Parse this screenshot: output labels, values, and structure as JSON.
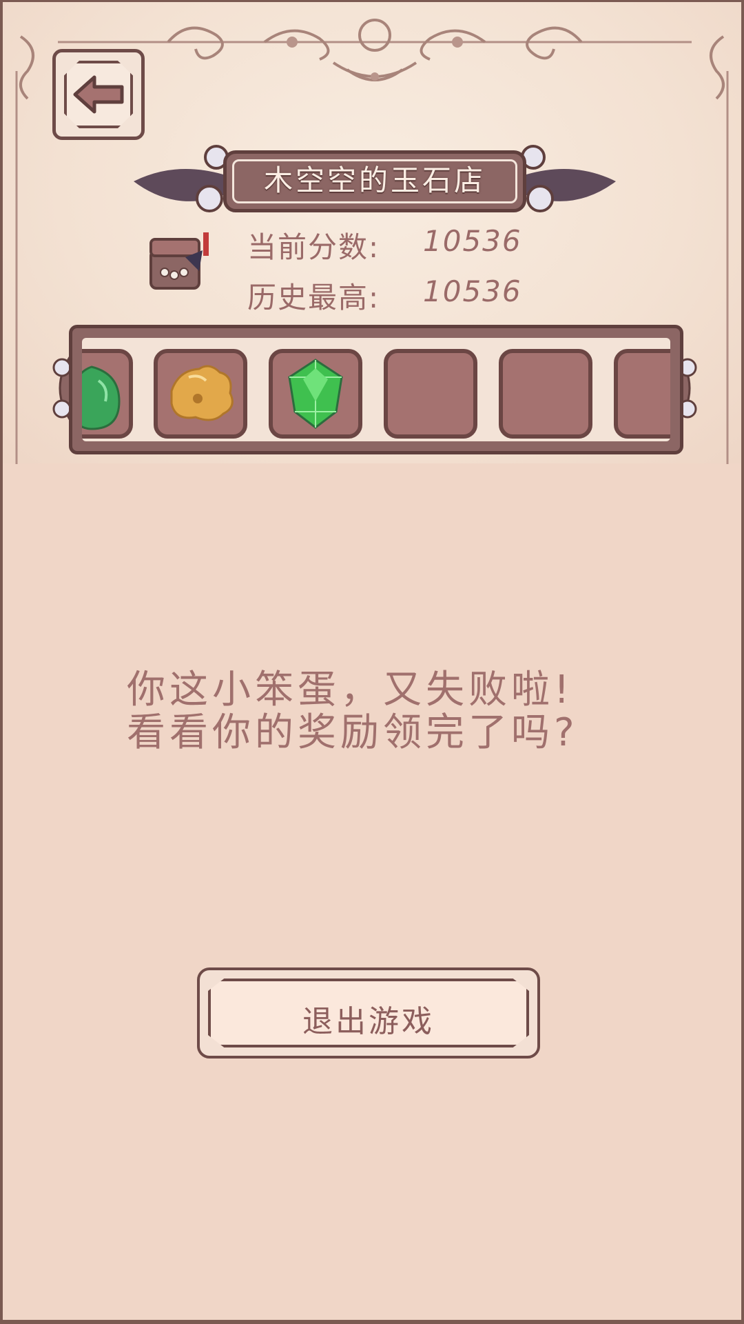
{
  "header": {
    "shop_title": "木空空的玉石店"
  },
  "scores": {
    "current_label": "当前分数:",
    "current_value": "10536",
    "best_label": "历史最高:",
    "best_value": "10536"
  },
  "inventory": {
    "slots": [
      {
        "item": "green-pouch-icon",
        "filled": true
      },
      {
        "item": "gold-nugget-icon",
        "filled": true
      },
      {
        "item": "green-gem-icon",
        "filled": true
      },
      {
        "item": "",
        "filled": false
      },
      {
        "item": "",
        "filled": false
      },
      {
        "item": "",
        "filled": false
      }
    ]
  },
  "message": {
    "line1": "你这小笨蛋，又失败啦!",
    "line2": "看看你的奖励领完了吗?"
  },
  "actions": {
    "exit_label": "退出游戏"
  },
  "colors": {
    "background": "#f0d6c7",
    "panel": "#f3e1d2",
    "frame_dark": "#6e4b48",
    "plate": "#8c6664",
    "text_rose": "#a0706d"
  }
}
